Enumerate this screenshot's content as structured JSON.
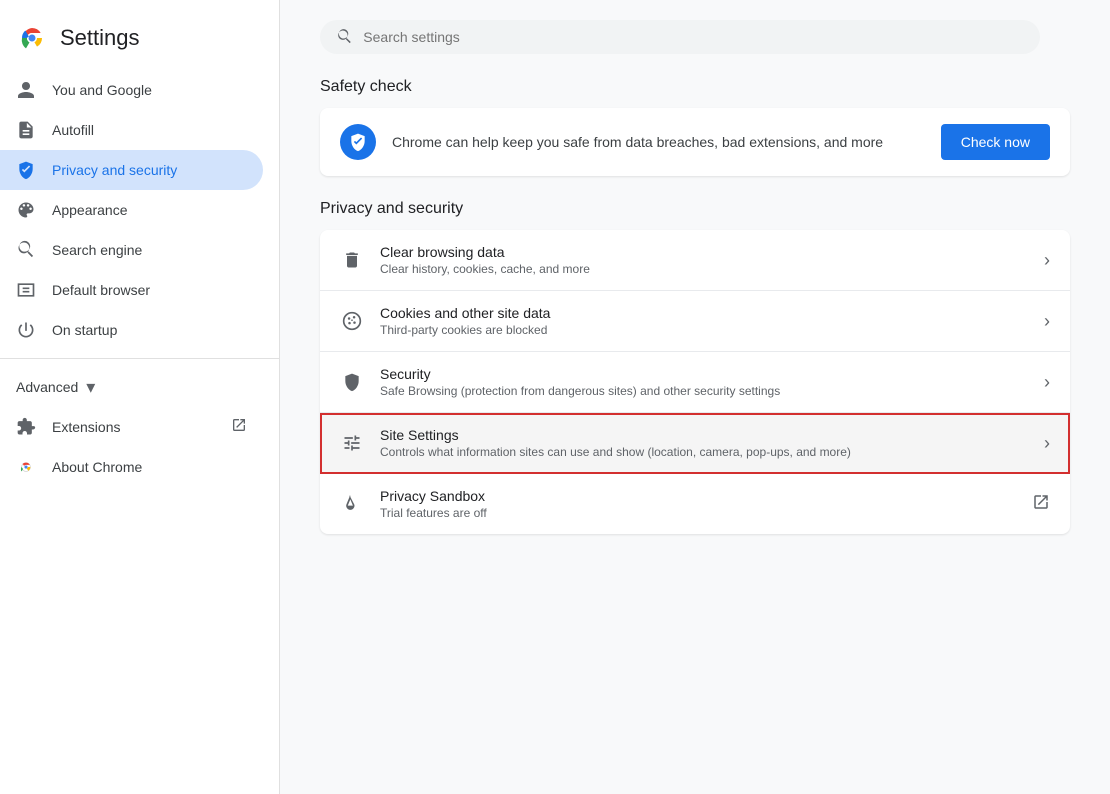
{
  "sidebar": {
    "title": "Settings",
    "items": [
      {
        "id": "you-and-google",
        "label": "You and Google",
        "icon": "person"
      },
      {
        "id": "autofill",
        "label": "Autofill",
        "icon": "description"
      },
      {
        "id": "privacy-and-security",
        "label": "Privacy and security",
        "icon": "shield",
        "active": true
      },
      {
        "id": "appearance",
        "label": "Appearance",
        "icon": "palette"
      },
      {
        "id": "search-engine",
        "label": "Search engine",
        "icon": "search"
      },
      {
        "id": "default-browser",
        "label": "Default browser",
        "icon": "browser"
      },
      {
        "id": "on-startup",
        "label": "On startup",
        "icon": "power"
      }
    ],
    "advanced_label": "Advanced",
    "extensions_label": "Extensions",
    "about_chrome_label": "About Chrome"
  },
  "search": {
    "placeholder": "Search settings"
  },
  "safety_check": {
    "section_title": "Safety check",
    "description": "Chrome can help keep you safe from data breaches, bad extensions, and more",
    "button_label": "Check now"
  },
  "privacy_section": {
    "section_title": "Privacy and security",
    "items": [
      {
        "id": "clear-browsing-data",
        "title": "Clear browsing data",
        "subtitle": "Clear history, cookies, cache, and more",
        "icon": "delete",
        "has_chevron": true,
        "highlighted": false,
        "has_external": false
      },
      {
        "id": "cookies-and-site-data",
        "title": "Cookies and other site data",
        "subtitle": "Third-party cookies are blocked",
        "icon": "cookie",
        "has_chevron": true,
        "highlighted": false,
        "has_external": false
      },
      {
        "id": "security",
        "title": "Security",
        "subtitle": "Safe Browsing (protection from dangerous sites) and other security settings",
        "icon": "shield-security",
        "has_chevron": true,
        "highlighted": false,
        "has_external": false
      },
      {
        "id": "site-settings",
        "title": "Site Settings",
        "subtitle": "Controls what information sites can use and show (location, camera, pop-ups, and more)",
        "icon": "tune",
        "has_chevron": true,
        "highlighted": true,
        "has_external": false
      },
      {
        "id": "privacy-sandbox",
        "title": "Privacy Sandbox",
        "subtitle": "Trial features are off",
        "icon": "flask",
        "has_chevron": false,
        "highlighted": false,
        "has_external": true
      }
    ]
  }
}
